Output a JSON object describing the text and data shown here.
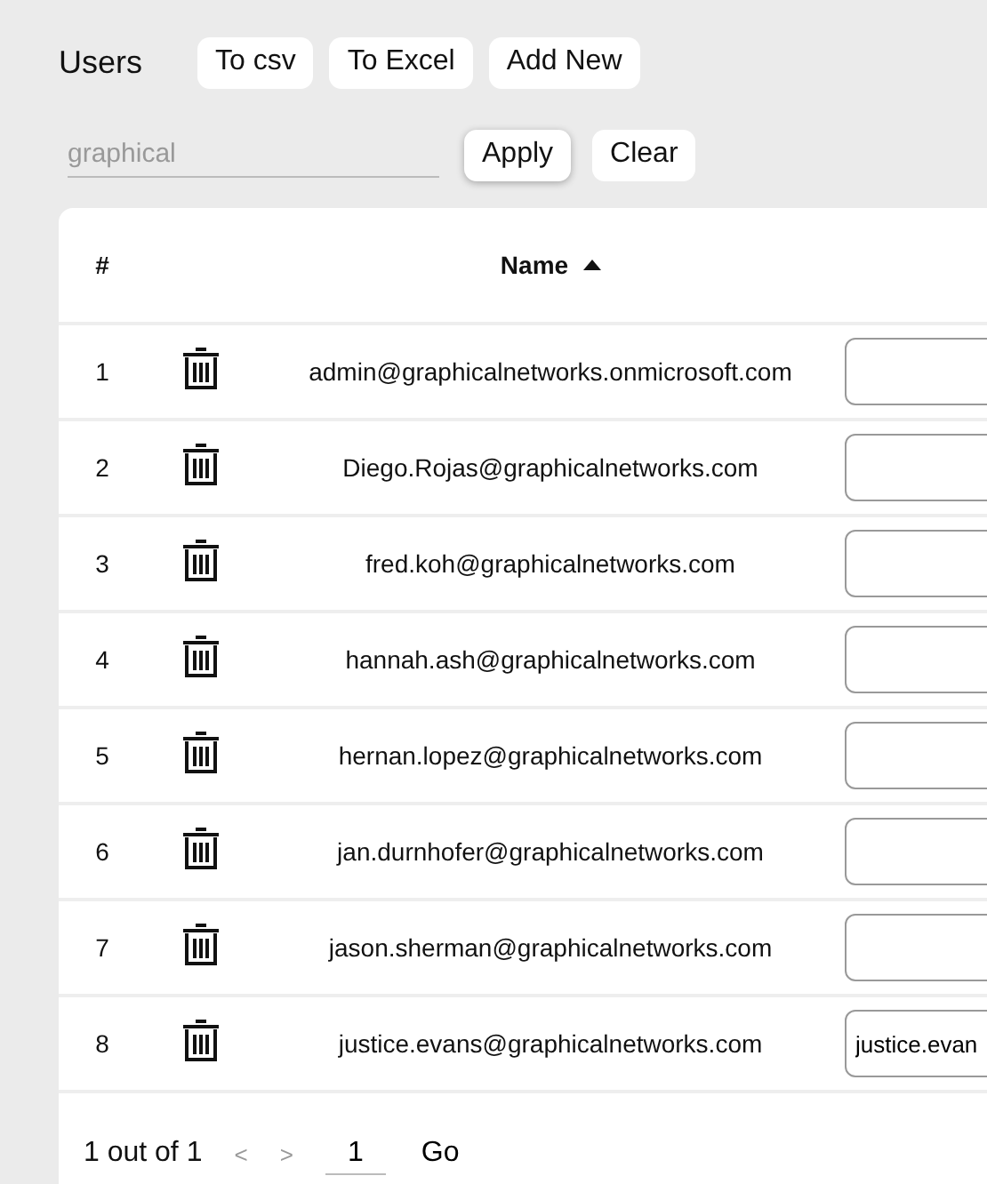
{
  "title": "Users",
  "toolbar_buttons": [
    "To csv",
    "To Excel",
    "Add New"
  ],
  "filter": {
    "value": "graphical",
    "buttons": [
      "Apply",
      "Clear"
    ]
  },
  "table": {
    "columns": [
      {
        "label": "#",
        "sorted": false
      },
      {
        "label": "Name",
        "sorted": true
      }
    ],
    "rows": [
      {
        "index": "1",
        "name": "admin@graphicalnetworks.onmicrosoft.com",
        "field": ""
      },
      {
        "index": "2",
        "name": "Diego.Rojas@graphicalnetworks.com",
        "field": ""
      },
      {
        "index": "3",
        "name": "fred.koh@graphicalnetworks.com",
        "field": ""
      },
      {
        "index": "4",
        "name": "hannah.ash@graphicalnetworks.com",
        "field": ""
      },
      {
        "index": "5",
        "name": "hernan.lopez@graphicalnetworks.com",
        "field": ""
      },
      {
        "index": "6",
        "name": "jan.durnhofer@graphicalnetworks.com",
        "field": ""
      },
      {
        "index": "7",
        "name": "jason.sherman@graphicalnetworks.com",
        "field": ""
      },
      {
        "index": "8",
        "name": "justice.evans@graphicalnetworks.com",
        "field": "justice.evan"
      }
    ]
  },
  "pager": {
    "summary": "1 out of 1",
    "prev": "<",
    "next": ">",
    "page": "1",
    "go": "Go"
  }
}
